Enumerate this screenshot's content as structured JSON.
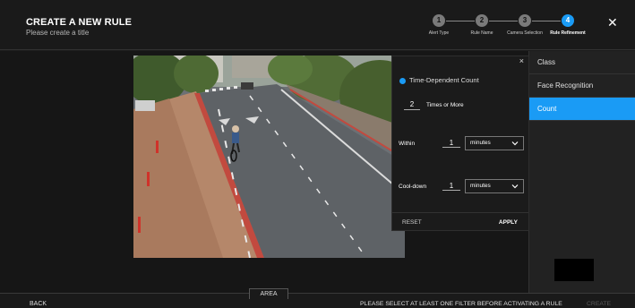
{
  "header": {
    "title": "CREATE A NEW RULE",
    "subtitle": "Please create a title",
    "steps": [
      {
        "num": "1",
        "label": "Alert Type"
      },
      {
        "num": "2",
        "label": "Rule Name"
      },
      {
        "num": "3",
        "label": "Camera Selection"
      },
      {
        "num": "4",
        "label": "Rule Refinement"
      }
    ],
    "close_icon": "close-icon"
  },
  "sidebar": {
    "items": [
      {
        "label": "Class"
      },
      {
        "label": "Face Recognition"
      },
      {
        "label": "Count"
      }
    ]
  },
  "panel": {
    "close": "×",
    "option": "Time-Dependent Count",
    "times_value": "2",
    "times_label": "Times or More",
    "within_label": "Within",
    "within_value": "1",
    "within_unit": "minutes",
    "cooldown_label": "Cool-down",
    "cooldown_value": "1",
    "cooldown_unit": "minutes",
    "reset_label": "RESET",
    "apply_label": "APPLY"
  },
  "footer": {
    "back_label": "BACK",
    "area_label": "AREA",
    "message": "PLEASE SELECT AT LEAST ONE FILTER BEFORE ACTIVATING A RULE",
    "create_label": "CREATE"
  },
  "colors": {
    "accent": "#1a9bf5",
    "background": "#1c1c1c"
  }
}
